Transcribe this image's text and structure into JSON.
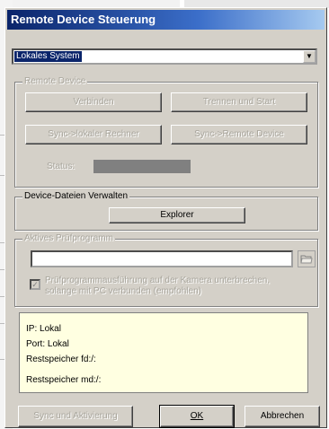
{
  "window": {
    "title": "Remote Device Steuerung"
  },
  "system_select": {
    "value": "Lokales System"
  },
  "remote_device": {
    "legend": "Remote Device",
    "connect_label": "Verbinden",
    "disconnect_label": "Trennen und Start",
    "sync_local_label": "Sync->lokaler Rechner",
    "sync_remote_label": "Sync->Remote Device",
    "status_label": "Status:"
  },
  "files": {
    "legend": "Device-Dateien Verwalten",
    "explorer_label": "Explorer"
  },
  "program": {
    "legend": "Aktives Prüfprogramm",
    "checkbox_line1": "Prüfprogrammausführung auf der Kamera unterbrechen,",
    "checkbox_line2": "solange mit PC verbunden (empfohlen)"
  },
  "info": {
    "ip": "IP: Lokal",
    "port": "Port: Lokal",
    "rest_fd": "Restspeicher fd:/:",
    "rest_md": "Restspeicher md:/:"
  },
  "footer": {
    "sync_activate_label": "Sync und Aktivierung",
    "ok_label": "OK",
    "cancel_label": "Abbrechen"
  },
  "colors": {
    "title_start": "#0a246a",
    "title_end": "#a6caf0",
    "dialog_face": "#d4d0c8",
    "info_bg": "#ffffe1"
  }
}
